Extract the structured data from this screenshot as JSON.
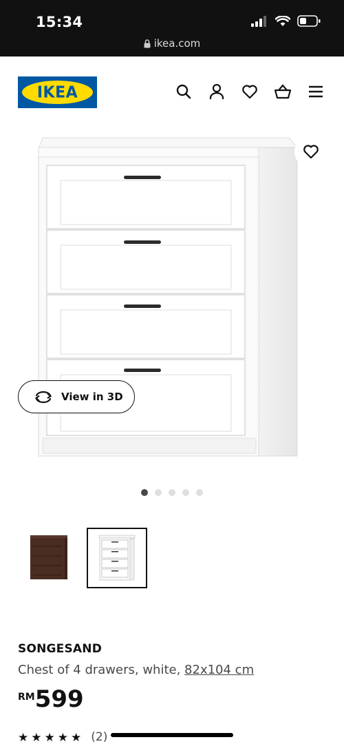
{
  "status_bar": {
    "time": "15:34",
    "url": "ikea.com"
  },
  "brand": {
    "logo_text": "IKEA",
    "colors": {
      "blue": "#0058a3",
      "yellow": "#ffdb00"
    }
  },
  "header_icons": [
    "search-icon",
    "user-icon",
    "heart-icon",
    "cart-icon",
    "menu-icon"
  ],
  "gallery": {
    "view_3d_label": "View in 3D",
    "dot_count": 5,
    "active_dot": 0,
    "thumbnails": [
      {
        "name": "brown-variant",
        "selected": false
      },
      {
        "name": "white-variant",
        "selected": true
      }
    ]
  },
  "product": {
    "name": "SONGESAND",
    "description": "Chest of 4 drawers, white, ",
    "dimensions": "82x104 cm",
    "currency": "RM",
    "price": "599",
    "rating_stars": 5,
    "review_count": "(2)"
  }
}
